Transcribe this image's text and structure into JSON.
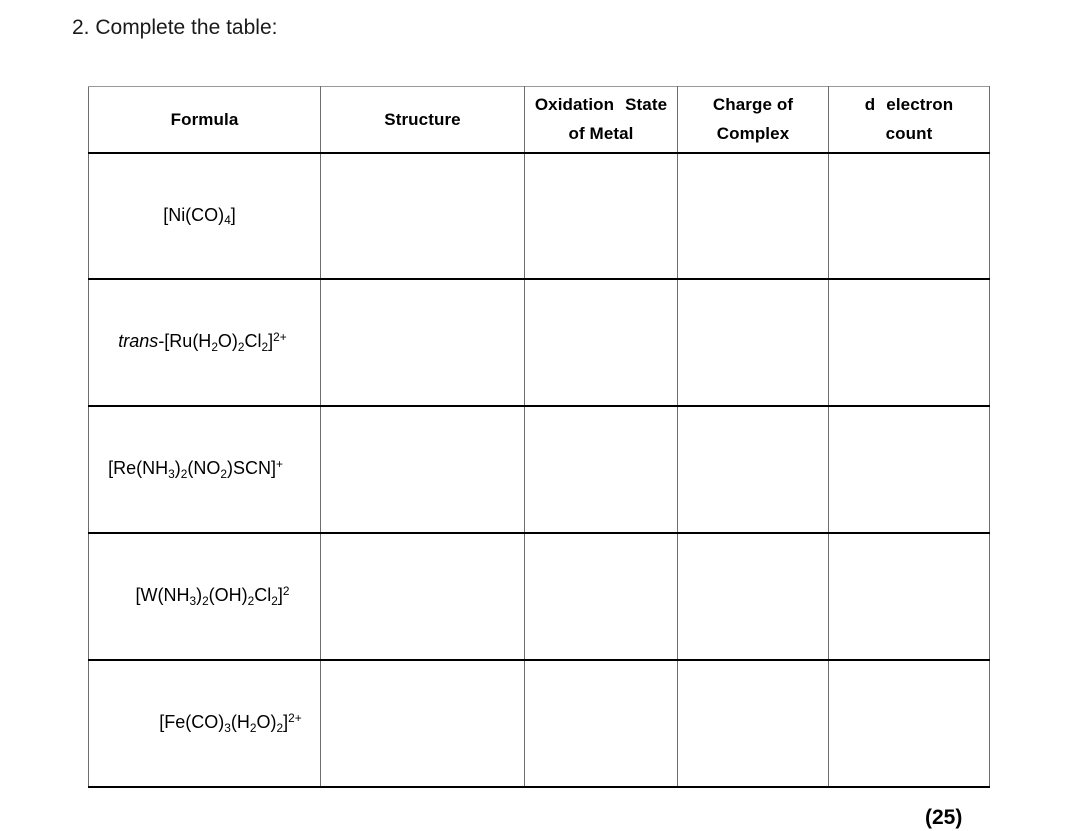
{
  "page": {
    "question_prompt": "2. Complete the table:",
    "marks_total": "(25)",
    "background_color": "#ffffff",
    "text_color": "#000000",
    "border_color": "#000000"
  },
  "table": {
    "headers": [
      {
        "id": "formula",
        "line1": "Formula",
        "line2": ""
      },
      {
        "id": "structure",
        "line1": "Structure",
        "line2": ""
      },
      {
        "id": "oxidation",
        "line1a": "Oxidation",
        "line1b": "State",
        "line2": "of Metal"
      },
      {
        "id": "charge",
        "line1": "Charge of",
        "line2": "Complex"
      },
      {
        "id": "dcount",
        "line1a": "d",
        "line1b": "electron",
        "line2": "count"
      }
    ],
    "rows": [
      {
        "formula_plain": "[Ni(CO)4]",
        "parts": [
          {
            "t": "[Ni(CO)",
            "s": "normal"
          },
          {
            "t": "4",
            "s": "sub"
          },
          {
            "t": "]",
            "s": "normal"
          }
        ],
        "structure": "",
        "oxidation_state": "",
        "charge_of_complex": "",
        "d_electron_count": ""
      },
      {
        "formula_plain": "trans-[Ru(H2O)2Cl2]2+",
        "parts": [
          {
            "t": "trans",
            "s": "italic"
          },
          {
            "t": "-[Ru(H",
            "s": "normal"
          },
          {
            "t": "2",
            "s": "sub"
          },
          {
            "t": "O)",
            "s": "normal"
          },
          {
            "t": "2",
            "s": "sub"
          },
          {
            "t": "Cl",
            "s": "normal"
          },
          {
            "t": "2",
            "s": "sub"
          },
          {
            "t": "]",
            "s": "normal"
          },
          {
            "t": "2+",
            "s": "sup"
          }
        ],
        "structure": "",
        "oxidation_state": "",
        "charge_of_complex": "",
        "d_electron_count": ""
      },
      {
        "formula_plain": "[Re(NH3)2(NO2)SCN]+",
        "parts": [
          {
            "t": "[Re(NH",
            "s": "normal"
          },
          {
            "t": "3",
            "s": "sub"
          },
          {
            "t": ")",
            "s": "normal"
          },
          {
            "t": "2",
            "s": "sub"
          },
          {
            "t": "(NO",
            "s": "normal"
          },
          {
            "t": "2",
            "s": "sub"
          },
          {
            "t": ")SCN]",
            "s": "normal"
          },
          {
            "t": "+",
            "s": "sup"
          }
        ],
        "structure": "",
        "oxidation_state": "",
        "charge_of_complex": "",
        "d_electron_count": ""
      },
      {
        "formula_plain": "[W(NH3)2(OH)2Cl2]2",
        "parts": [
          {
            "t": "[W(NH",
            "s": "normal"
          },
          {
            "t": "3",
            "s": "sub"
          },
          {
            "t": ")",
            "s": "normal"
          },
          {
            "t": "2",
            "s": "sub"
          },
          {
            "t": "(OH)",
            "s": "normal"
          },
          {
            "t": "2",
            "s": "sub"
          },
          {
            "t": "Cl",
            "s": "normal"
          },
          {
            "t": "2",
            "s": "sub"
          },
          {
            "t": "]",
            "s": "normal"
          },
          {
            "t": "2",
            "s": "sup"
          }
        ],
        "structure": "",
        "oxidation_state": "",
        "charge_of_complex": "",
        "d_electron_count": ""
      },
      {
        "formula_plain": "[Fe(CO)3(H2O)2]2+",
        "parts": [
          {
            "t": "[Fe(CO)",
            "s": "normal"
          },
          {
            "t": "3",
            "s": "sub"
          },
          {
            "t": "(H",
            "s": "normal"
          },
          {
            "t": "2",
            "s": "sub"
          },
          {
            "t": "O)",
            "s": "normal"
          },
          {
            "t": "2",
            "s": "sub"
          },
          {
            "t": "]",
            "s": "normal"
          },
          {
            "t": "2+",
            "s": "sup"
          }
        ],
        "structure": "",
        "oxidation_state": "",
        "charge_of_complex": "",
        "d_electron_count": ""
      }
    ]
  }
}
